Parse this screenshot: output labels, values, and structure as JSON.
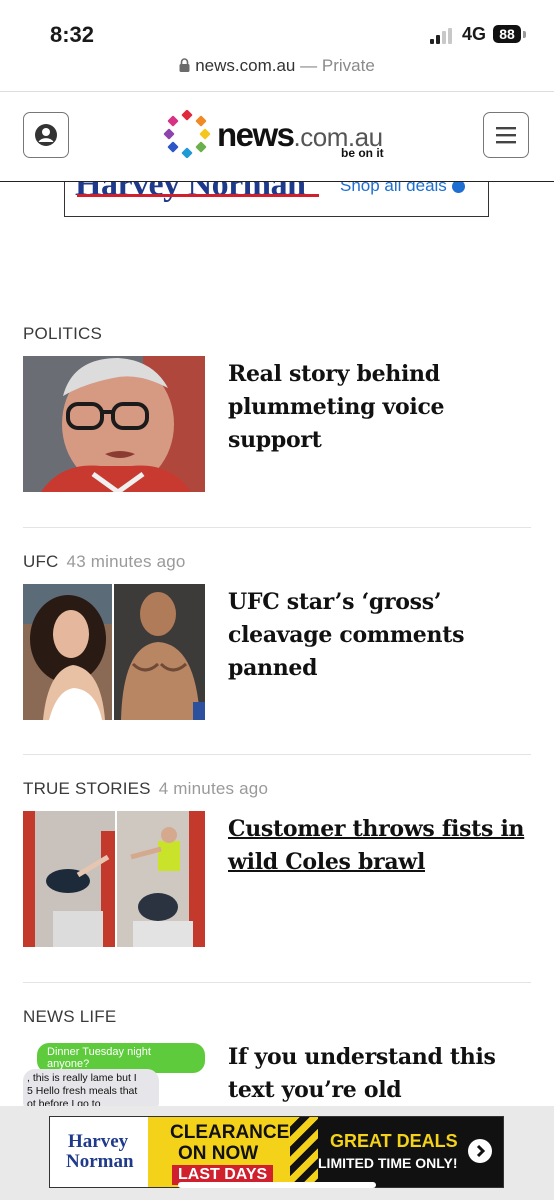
{
  "status": {
    "time": "8:32",
    "network": "4G",
    "battery": "88"
  },
  "browser": {
    "url": "news.com.au",
    "separator": "—",
    "mode": "Private"
  },
  "header": {
    "logo_main": "news",
    "logo_suffix": ".com.au",
    "logo_tagline": "be on it",
    "account_icon": "user-circle-icon",
    "menu_icon": "hamburger-menu-icon"
  },
  "top_ad": {
    "brand": "Harvey Norman",
    "cta": "Shop all deals"
  },
  "stories": [
    {
      "category": "POLITICS",
      "time": "",
      "headline": "Real story behind plummeting voice support"
    },
    {
      "category": "UFC",
      "time": "43 minutes ago",
      "headline": "UFC star’s ‘gross’ cleavage comments panned"
    },
    {
      "category": "TRUE STORIES",
      "time": "4 minutes ago",
      "headline": "Customer throws fists in wild Coles brawl"
    },
    {
      "category": "NEWS LIFE",
      "time": "",
      "headline": "If you understand this text you’re old"
    }
  ],
  "text_thumb": {
    "bubble": "Dinner Tuesday night anyone?",
    "line1": ", this is really lame but I",
    "line2": "5 Hello fresh meals that",
    "line3": "ot before I go to"
  },
  "bottom_ad": {
    "brand_line1": "Harvey",
    "brand_line2": "Norman",
    "clearance_1": "CLEARANCE",
    "clearance_2": "ON NOW",
    "clearance_3": "LAST DAYS",
    "deals_1": "GREAT DEALS",
    "deals_2": "LIMITED TIME ONLY!"
  }
}
